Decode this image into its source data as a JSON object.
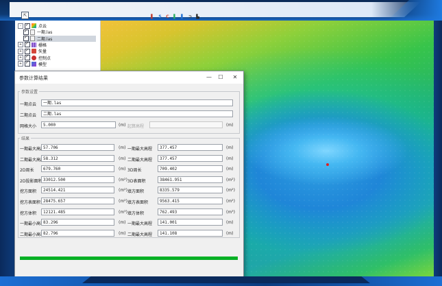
{
  "toolbar": {
    "items": [
      {
        "glyph": "▌",
        "color": "#c0392b"
      },
      {
        "glyph": "S",
        "color": "#1f6fd1"
      },
      {
        "glyph": "C",
        "color": "#d4472e"
      },
      {
        "glyph": "▌",
        "color": "#27ae60"
      },
      {
        "glyph": "▌",
        "color": "#1f6fd1"
      },
      {
        "glyph": "⊃",
        "color": "#2b2b2b"
      },
      {
        "glyph": "▙",
        "color": "#2b2b2b"
      }
    ],
    "corner_glyph": "⇱"
  },
  "layer_tree": {
    "items": [
      {
        "label": "点云",
        "expander": "-",
        "checked": true,
        "icon": "point-cloud-icon",
        "selected": false
      },
      {
        "label": "一期.las",
        "expander": "",
        "checked": true,
        "icon": "file-icon",
        "selected": false
      },
      {
        "label": "二期.las",
        "expander": "",
        "checked": true,
        "icon": "file-icon",
        "selected": true
      },
      {
        "label": "栅格",
        "expander": "+",
        "checked": true,
        "icon": "raster-icon",
        "selected": false
      },
      {
        "label": "矢量",
        "expander": "+",
        "checked": true,
        "icon": "vector-icon",
        "selected": false
      },
      {
        "label": "控制点",
        "expander": "+",
        "checked": true,
        "icon": "control-point-icon",
        "selected": false
      },
      {
        "label": "模型",
        "expander": "+",
        "checked": true,
        "icon": "model-icon",
        "selected": false
      }
    ]
  },
  "dialog": {
    "title": "参数计算结果",
    "minimize_glyph": "—",
    "maximize_glyph": "☐",
    "close_glyph": "✕",
    "params": {
      "legend": "参数设置",
      "phase1_label": "一期点云",
      "phase1_value": "一期.las",
      "phase2_label": "二期点云",
      "phase2_value": "二期.las",
      "grid_label": "网格大小",
      "grid_value": "5.000",
      "grid_unit": "(m)",
      "base_label": "起算高程",
      "base_value": "",
      "base_unit": "(m)"
    },
    "results": {
      "legend": "结果",
      "rows": [
        {
          "l_label": "一期最大高度",
          "l_value": "57.706",
          "l_unit": "(m)",
          "r_label": "一期最大高程",
          "r_value": "377.457",
          "r_unit": "(m)"
        },
        {
          "l_label": "二期最大高度",
          "l_value": "58.312",
          "l_unit": "(m)",
          "r_label": "二期最大高程",
          "r_value": "377.457",
          "r_unit": "(m)"
        },
        {
          "l_label": "2D周长",
          "l_value": "679.760",
          "l_unit": "(m)",
          "r_label": "3D周长",
          "r_value": "709.402",
          "r_unit": "(m)"
        },
        {
          "l_label": "2D投影面积",
          "l_value": "33012.500",
          "l_unit": "(m²)",
          "r_label": "3D表面积",
          "r_value": "38461.951",
          "r_unit": "(m²)"
        },
        {
          "l_label": "挖方面积",
          "l_value": "24514.421",
          "l_unit": "(m²)",
          "r_label": "填方面积",
          "r_value": "8335.579",
          "r_unit": "(m²)"
        },
        {
          "l_label": "挖方表面积",
          "l_value": "28475.657",
          "l_unit": "(m²)",
          "r_label": "填方表面积",
          "r_value": "9563.415",
          "r_unit": "(m²)"
        },
        {
          "l_label": "挖方体积",
          "l_value": "12121.485",
          "l_unit": "(m³)",
          "r_label": "填方体积",
          "r_value": "762.493",
          "r_unit": "(m³)"
        },
        {
          "l_label": "一期最小高程",
          "l_value": "83.296",
          "l_unit": "(m)",
          "r_label": "一期最大高程",
          "r_value": "141.001",
          "r_unit": "(m)"
        },
        {
          "l_label": "二期最小高程",
          "l_value": "82.796",
          "l_unit": "(m)",
          "r_label": "二期最大高程",
          "r_value": "141.108",
          "r_unit": "(m)"
        }
      ]
    },
    "progress": 1.0
  },
  "colors": {
    "progress_fill": "#06b025",
    "map_marker": "#e02020"
  }
}
